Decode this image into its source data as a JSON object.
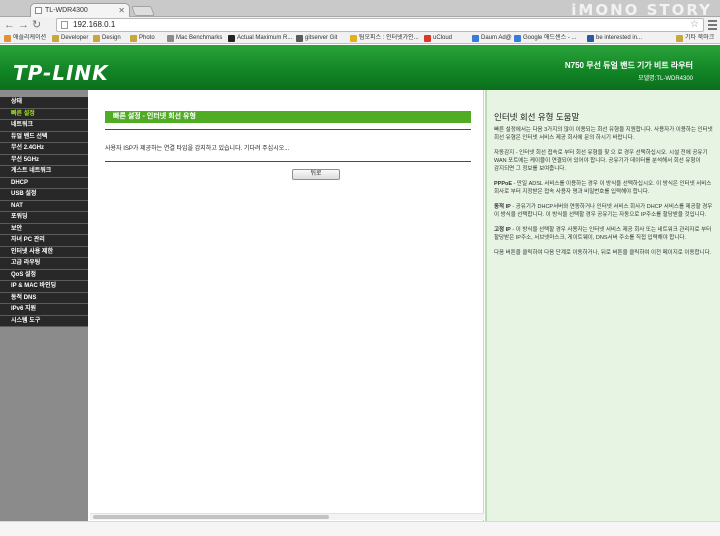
{
  "browser": {
    "tab_title": "TL-WDR4300",
    "url": "192.168.0.1",
    "watermark": "iMONO STORY",
    "bookmarks": [
      {
        "label": "애플리케이션",
        "color": "#e0923a"
      },
      {
        "label": "Developer",
        "color": "#c8a640"
      },
      {
        "label": "Design",
        "color": "#c8a640"
      },
      {
        "label": "Photo",
        "color": "#c8a640"
      },
      {
        "label": "Mac Benchmarks",
        "color": "#8a8a8a"
      },
      {
        "label": "Actual Maximum R...",
        "color": "#222222"
      },
      {
        "label": "gitserver Git",
        "color": "#5a5a5a"
      },
      {
        "label": "팀오피스 : 인터넷가인...",
        "color": "#e0b020"
      },
      {
        "label": "uCloud",
        "color": "#d83a2a"
      },
      {
        "label": "Daum Ad@m",
        "color": "#3a7ad8"
      },
      {
        "label": "Google 애드센스 - ...",
        "color": "#3a7ad8"
      },
      {
        "label": "be interested in...",
        "color": "#2a5aa0"
      },
      {
        "label": "기타 북마크",
        "color": "#c8a640"
      }
    ]
  },
  "router": {
    "brand": "TP-LINK",
    "product_title": "N750 무선 듀얼 밴드 기가 비트 라우터",
    "model_line": "모델명:TL-WDR4300",
    "accent_color": "#a0e81a",
    "menu": [
      {
        "label": "상태",
        "active": false
      },
      {
        "label": "빠른 설정",
        "active": true
      },
      {
        "label": "네트워크",
        "active": false
      },
      {
        "label": "듀얼 밴드 선택",
        "active": false
      },
      {
        "label": "무선 2.4GHz",
        "active": false
      },
      {
        "label": "무선 5GHz",
        "active": false
      },
      {
        "label": "게스트 네트워크",
        "active": false
      },
      {
        "label": "DHCP",
        "active": false
      },
      {
        "label": "USB 설정",
        "active": false
      },
      {
        "label": "NAT",
        "active": false
      },
      {
        "label": "포워딩",
        "active": false
      },
      {
        "label": "보안",
        "active": false
      },
      {
        "label": "자녀 PC 관리",
        "active": false
      },
      {
        "label": "인터넷 사용 제한",
        "active": false
      },
      {
        "label": "고급 라우팅",
        "active": false
      },
      {
        "label": "QoS 설정",
        "active": false
      },
      {
        "label": "IP & MAC 바인딩",
        "active": false
      },
      {
        "label": "동적 DNS",
        "active": false
      },
      {
        "label": "IPv6 지원",
        "active": false
      },
      {
        "label": "시스템 도구",
        "active": false
      }
    ],
    "wizard": {
      "title": "빠른 설정 - 인터넷 회선 유형",
      "message": "사용자 ISP가 제공하는 연결 타입을 감지하고 있습니다. 기다려 주십시오...",
      "back_button": "뒤로"
    },
    "help": {
      "title": "인터넷 회선 유형 도움말",
      "paragraphs": [
        {
          "lead": "",
          "text": "빠른 설정에서는 다음 3가지의 많이 이용되는 회선 유형을 지원합니다. 사용자가 이용하는 인터넷 회선 유형은 인터넷 서비스 제공 회사에 문의 하시기 바랍니다."
        },
        {
          "lead": "",
          "text": "자동감지 - 인터넷 회선 접속로 부터 회선 유형을 찾 으 로 경우 선택하십시오. 시설 전에 공유기 WAN 포트에는 케이블이 연결되어 있어야 합니다. 공유기가 데이터를 분석해서 회선 유형이 감지되면 그 정보를 보여줍니다."
        },
        {
          "lead": "PPPoE",
          "text": " - 만일 ADSL 서비스를 이용하는 경우 이 방식을 선택하십시오. 이 방식은 인터넷 서비스 회사로 부터 지정받은 접속 사용자 명과 비밀번호를 입력해야 합니다."
        },
        {
          "lead": "동적 IP",
          "text": " - 공유기가 DHCP서버와 연동하거나 인터넷 서비스 회사가 DHCP 서비스를 제공할 경우 이 방식을 선택합니다. 이 방식을 선택할 경우 공유기는 자동으로 IP주소를 할당받을 것입니다."
        },
        {
          "lead": "고정 IP",
          "text": " - 이 방식을 선택할 경우 사용자는 인터넷 서비스 제공 회사 또는 네트워크 관리자로 부터 할당받은 IP주소, 서브넷마스크, 게이트웨이, DNS서버 주소를 직접 입력해야 합니다."
        },
        {
          "lead": "",
          "text": "다음 버튼을 클릭하여 다음 단계로 이동하거나, 뒤로 버튼을 클릭하여 이전 페이지로 이동합니다."
        }
      ]
    }
  }
}
